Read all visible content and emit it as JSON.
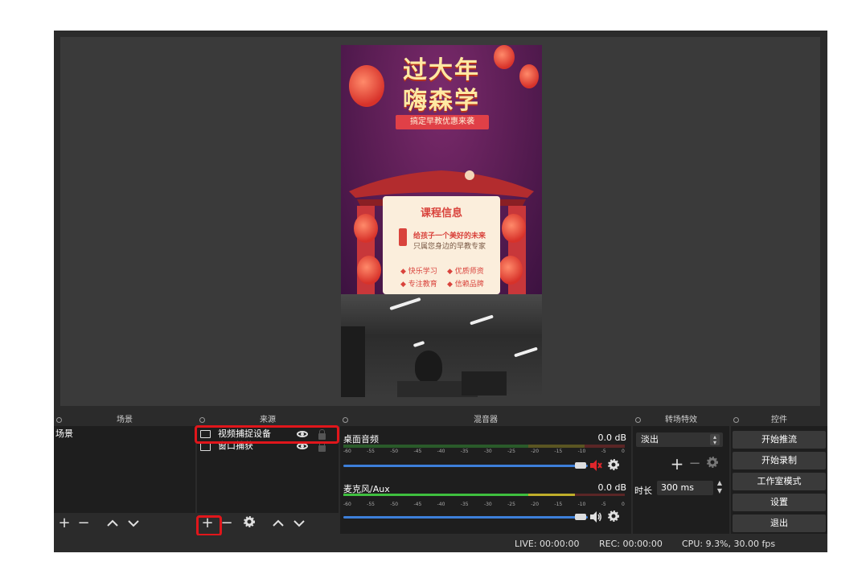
{
  "preview": {
    "poster": {
      "title_line1": "过大年",
      "title_line2": "嗨森学",
      "ribbon": "搞定早教优惠来袭",
      "card_title": "课程信息",
      "card_line1": "给孩子一个美好的未来",
      "card_line2": "只属您身边的早教专家",
      "tags": [
        "◆ 快乐学习",
        "◆ 优质师资",
        "◆ 专注教育",
        "◆ 信赖品牌"
      ]
    }
  },
  "scenes": {
    "header": "场景",
    "items": [
      "场景"
    ]
  },
  "sources": {
    "header": "来源",
    "items": [
      {
        "label": "视频捕捉设备",
        "icon": "camera-icon"
      },
      {
        "label": "窗口捕获",
        "icon": "window-icon"
      }
    ]
  },
  "mixer": {
    "header": "混音器",
    "scale": [
      "-60",
      "-55",
      "-50",
      "-45",
      "-40",
      "-35",
      "-30",
      "-25",
      "-20",
      "-15",
      "-10",
      "-5",
      "0"
    ],
    "tracks": [
      {
        "name": "桌面音频",
        "db": "0.0 dB",
        "muted": true,
        "volume_fraction": 1.0
      },
      {
        "name": "麦克风/Aux",
        "db": "0.0 dB",
        "muted": false,
        "volume_fraction": 1.0
      }
    ]
  },
  "transitions": {
    "header": "转场特效",
    "selected": "淡出",
    "duration_label": "时长",
    "duration_value": "300 ms"
  },
  "controls": {
    "header": "控件",
    "buttons": [
      "开始推流",
      "开始录制",
      "工作室模式",
      "设置",
      "退出"
    ]
  },
  "status": {
    "live": "LIVE: 00:00:00",
    "rec": "REC: 00:00:00",
    "cpu": "CPU: 9.3%, 30.00 fps"
  },
  "colors": {
    "highlight": "#e0161b",
    "slider": "#3d7fd9",
    "meter_green": "#3fbf3f",
    "meter_yellow": "#bfae2a",
    "meter_red": "#c23b3b",
    "mute_red": "#e0262b"
  }
}
